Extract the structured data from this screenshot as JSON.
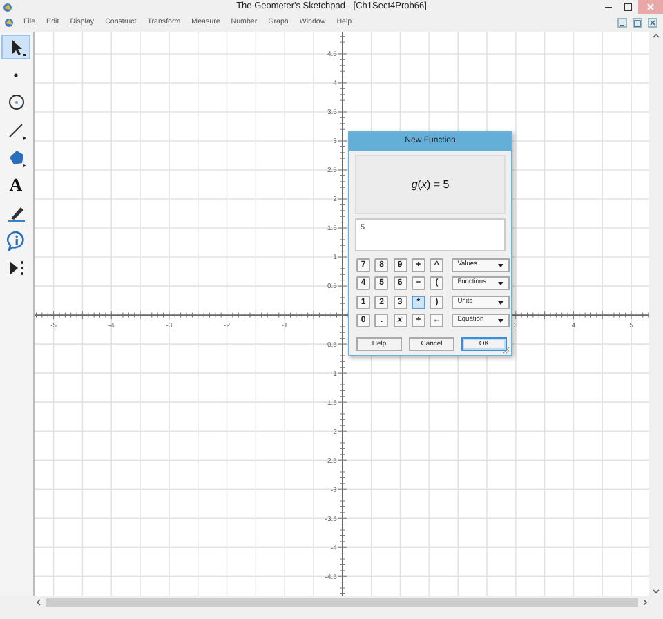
{
  "window": {
    "title": "The Geometer's Sketchpad - [Ch1Sect4Prob66]"
  },
  "menu": [
    "File",
    "Edit",
    "Display",
    "Construct",
    "Transform",
    "Measure",
    "Number",
    "Graph",
    "Window",
    "Help"
  ],
  "toolbox": [
    {
      "kind": "arrow",
      "selected": true
    },
    {
      "kind": "point",
      "selected": false
    },
    {
      "kind": "compass",
      "selected": false
    },
    {
      "kind": "straightedge",
      "selected": false
    },
    {
      "kind": "polygon",
      "selected": false
    },
    {
      "kind": "text",
      "glyph": "A",
      "selected": false
    },
    {
      "kind": "marker",
      "selected": false
    },
    {
      "kind": "info",
      "selected": false
    },
    {
      "kind": "custom",
      "selected": false
    }
  ],
  "canvas": {
    "chart_data": {
      "type": "line",
      "grid": true,
      "xlim": [
        -5.33,
        5.31
      ],
      "ylim": [
        -4.83,
        4.88
      ],
      "xticks": [
        -5,
        -4,
        -3,
        -2,
        -1,
        3,
        4,
        5
      ],
      "yticks": [
        4.5,
        4,
        3.5,
        3,
        2.5,
        2,
        1.5,
        1,
        0.5,
        -0.5,
        -1,
        -1.5,
        -2,
        -2.5,
        -3,
        -3.5,
        -4,
        -4.5
      ]
    }
  },
  "dialog": {
    "title": "New Function",
    "expression": "*g*(*x*) = 5",
    "input_value": "5",
    "keys": [
      {
        "label": "7",
        "pressed": false
      },
      {
        "label": "8",
        "pressed": false
      },
      {
        "label": "9",
        "pressed": false
      },
      {
        "label": "+",
        "pressed": false
      },
      {
        "label": "^",
        "pressed": false
      },
      {
        "label": "4",
        "pressed": false
      },
      {
        "label": "5",
        "pressed": false
      },
      {
        "label": "6",
        "pressed": false
      },
      {
        "label": "−",
        "pressed": false
      },
      {
        "label": "(",
        "pressed": false
      },
      {
        "label": "1",
        "pressed": false
      },
      {
        "label": "2",
        "pressed": false
      },
      {
        "label": "3",
        "pressed": false
      },
      {
        "label": "*",
        "pressed": true
      },
      {
        "label": ")",
        "pressed": false
      },
      {
        "label": "0",
        "pressed": false
      },
      {
        "label": ".",
        "pressed": false
      },
      {
        "label": "x",
        "italic": true,
        "pressed": false
      },
      {
        "label": "÷",
        "pressed": false
      },
      {
        "label": "←",
        "pressed": false
      }
    ],
    "menus": [
      "Values",
      "Functions",
      "Units",
      "Equation"
    ],
    "buttons": [
      {
        "label": "Help",
        "default": false
      },
      {
        "label": "Cancel",
        "default": false
      },
      {
        "label": "OK",
        "default": true
      }
    ]
  }
}
